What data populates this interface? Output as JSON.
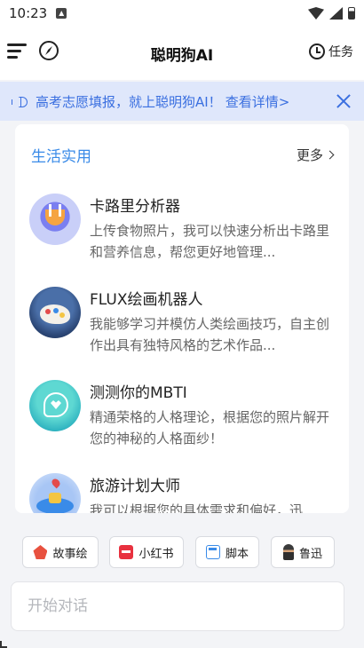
{
  "status_bar": {
    "time": "10:23"
  },
  "header": {
    "title": "聪明狗AI",
    "tasks_label": "任务"
  },
  "banner": {
    "text": "高考志愿填报，就上聪明狗AI！",
    "link": "查看详情>"
  },
  "section": {
    "title": "生活实用",
    "more_label": "更多",
    "items": [
      {
        "name": "卡路里分析器",
        "desc": "上传食物照片，我可以快速分析出卡路里和营养信息，帮您更好地管理...",
        "icon": "calorie-analyzer-avatar"
      },
      {
        "name": "FLUX绘画机器人",
        "desc": "我能够学习并模仿人类绘画技巧，自主创作出具有独特风格的艺术作品...",
        "icon": "painting-palette-avatar"
      },
      {
        "name": "测测你的MBTI",
        "desc": "精通荣格的人格理论，根据您的照片解开您的神秘的人格面纱！",
        "icon": "mbti-heart-avatar"
      },
      {
        "name": "旅游计划大师",
        "desc": "我可以根据您的具体需求和偏好，迅",
        "icon": "travel-planner-avatar"
      }
    ]
  },
  "chips": [
    {
      "label": "故事绘",
      "icon": "story-icon"
    },
    {
      "label": "小红书",
      "icon": "xiaohongshu-icon"
    },
    {
      "label": "脚本",
      "icon": "script-icon"
    },
    {
      "label": "鲁迅",
      "icon": "luxun-icon"
    }
  ],
  "composer": {
    "placeholder": "开始对话"
  },
  "colors": {
    "accent": "#3a8be8",
    "banner_bg": "#dfe7fb",
    "banner_text": "#3a6fe0",
    "page_bg": "#f3f4f7"
  }
}
